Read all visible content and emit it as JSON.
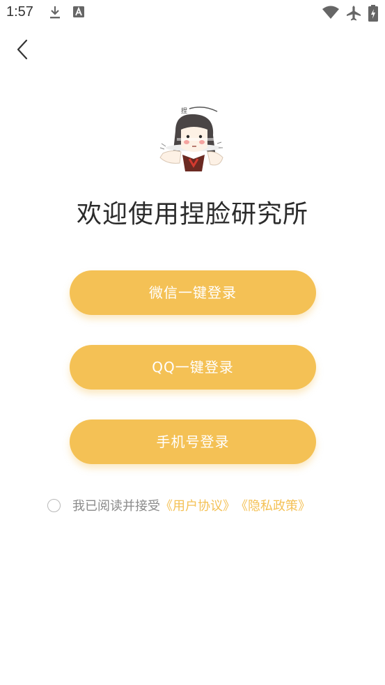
{
  "status_bar": {
    "time": "1:57",
    "icons": [
      "download-icon",
      "font-app-icon",
      "wifi-icon",
      "airplane-icon",
      "battery-charging-icon"
    ]
  },
  "nav": {
    "back_icon": "chevron-left-icon"
  },
  "title": "欢迎使用捏脸研究所",
  "mascot": {
    "label": "捏"
  },
  "buttons": {
    "wechat": "微信一键登录",
    "qq": "QQ一键登录",
    "phone": "手机号登录"
  },
  "agreement": {
    "prefix": "我已阅读并接受",
    "user_agreement": "《用户协议》",
    "privacy_policy": "《隐私政策》",
    "checked": false
  },
  "colors": {
    "accent": "#f4c155",
    "muted_text": "#8a8a8a",
    "title_text": "#2b2b2b"
  }
}
